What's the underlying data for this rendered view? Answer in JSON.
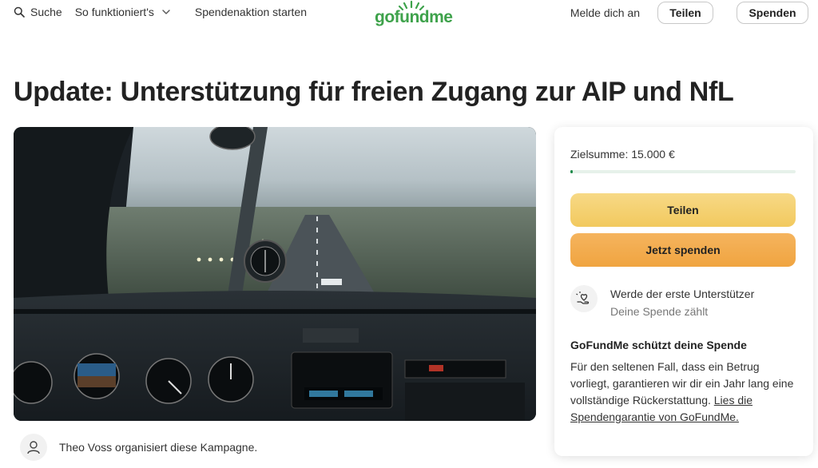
{
  "header": {
    "search_label": "Suche",
    "how_it_works_label": "So funktioniert's",
    "start_label": "Spendenaktion starten",
    "logo_text": "gofundme",
    "login_label": "Melde dich an",
    "share_label": "Teilen",
    "donate_label": "Spenden"
  },
  "page": {
    "title": "Update: Unterstützung für freien Zugang zur AIP und NfL"
  },
  "hero": {
    "icon": "cockpit-runway-photo"
  },
  "organizer": {
    "text": "Theo Voss organisiert diese Kampagne."
  },
  "card": {
    "goal_text": "Zielsumme: 15.000 €",
    "progress_fraction": 0.01,
    "share_button": "Teilen",
    "donate_button": "Jetzt spenden",
    "supporter_title": "Werde der erste Unterstützer",
    "supporter_subtitle": "Deine Spende zählt",
    "protection_title": "GoFundMe schützt deine Spende",
    "protection_body": "Für den seltenen Fall, dass ein Betrug vorliegt, garantieren wir dir ein Jahr lang eine vollständige Rückerstattung.",
    "protection_link": "Lies die Spendengarantie von GoFundMe."
  },
  "colors": {
    "brand_green": "#3ea24b",
    "share_yellow": "#f2c95e",
    "donate_orange": "#f0a440",
    "progress_green": "#1e8a4a"
  }
}
